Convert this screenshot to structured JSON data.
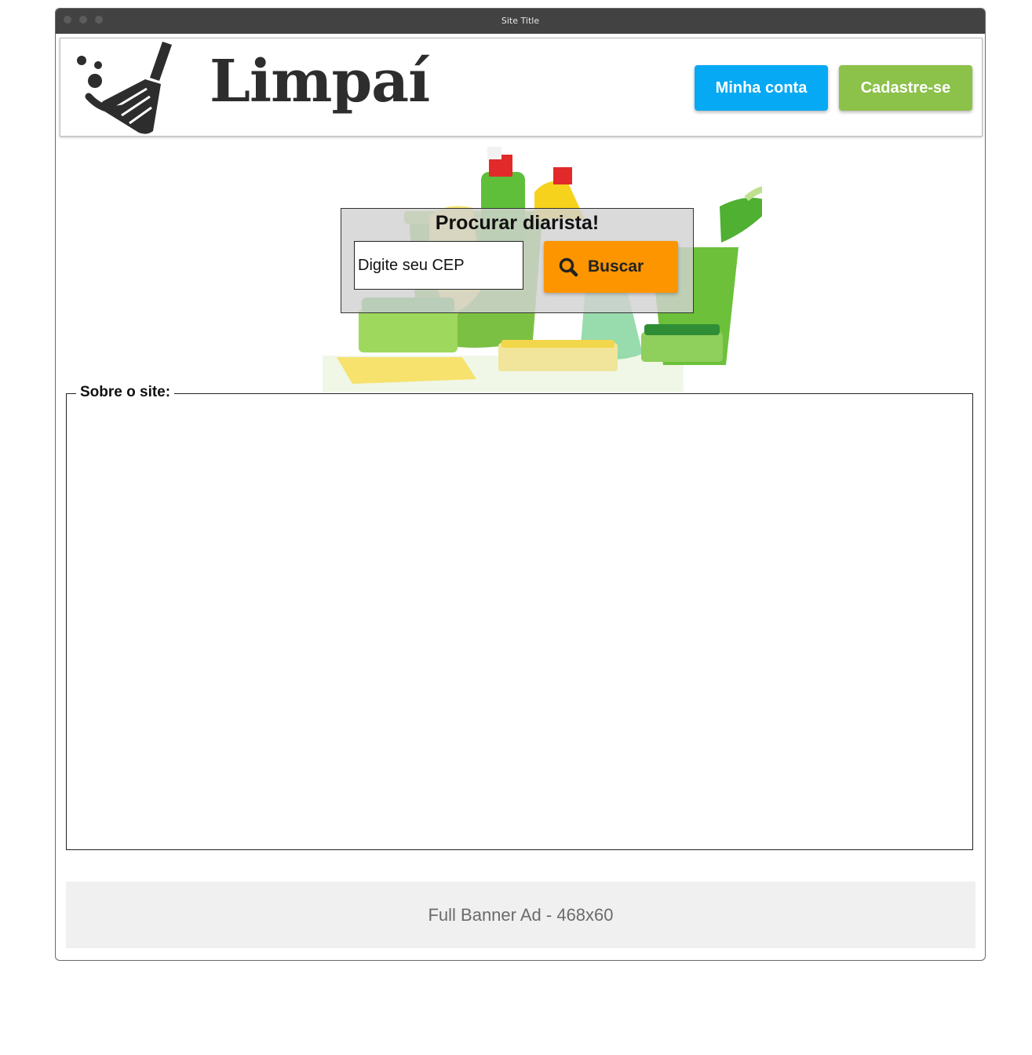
{
  "window": {
    "title": "Site Title"
  },
  "header": {
    "logo_text": "Limpaí",
    "account_button": "Minha conta",
    "signup_button": "Cadastre-se"
  },
  "search": {
    "title": "Procurar diarista!",
    "placeholder": "Digite seu CEP",
    "button_label": "Buscar"
  },
  "about": {
    "legend": "Sobre o site:"
  },
  "ad": {
    "label": "Full Banner Ad - 468x60"
  },
  "colors": {
    "account_button": "#06a9f4",
    "signup_button": "#8cc14a",
    "search_button": "#fd9500",
    "titlebar": "#424242"
  },
  "icons": [
    "broom-logo-icon",
    "search-icon",
    "cleaning-products-image"
  ]
}
